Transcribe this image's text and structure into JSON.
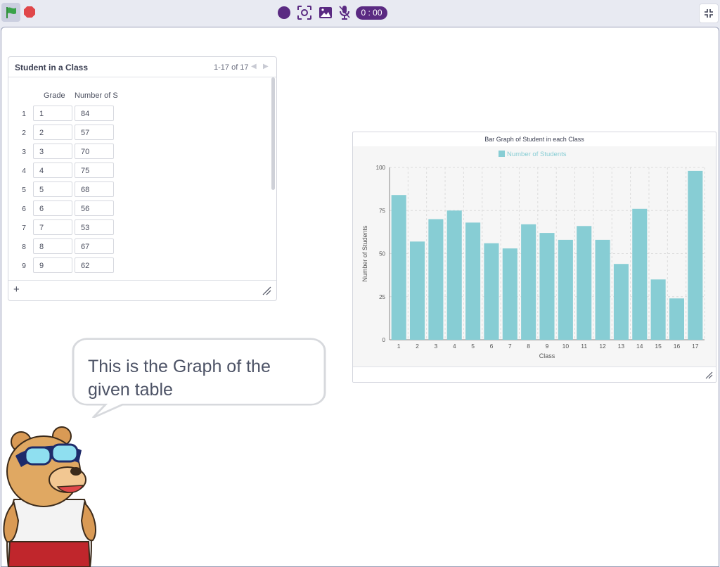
{
  "toolbar": {
    "timer": "0 : 00",
    "icons": [
      "green-flag-icon",
      "stop-icon",
      "record-icon",
      "screenshot-icon",
      "image-icon",
      "microphone-icon",
      "fullscreen-exit-icon"
    ],
    "colors": {
      "flag": "#2f8f3a",
      "stop": "#e0474a",
      "accent": "#5a2a82"
    }
  },
  "table": {
    "title": "Student in a Class",
    "range": "1-17 of 17",
    "columns": [
      "Grade",
      "Number of S"
    ],
    "rows": [
      {
        "n": "1",
        "grade": "1",
        "count": "84"
      },
      {
        "n": "2",
        "grade": "2",
        "count": "57"
      },
      {
        "n": "3",
        "grade": "3",
        "count": "70"
      },
      {
        "n": "4",
        "grade": "4",
        "count": "75"
      },
      {
        "n": "5",
        "grade": "5",
        "count": "68"
      },
      {
        "n": "6",
        "grade": "6",
        "count": "56"
      },
      {
        "n": "7",
        "grade": "7",
        "count": "53"
      },
      {
        "n": "8",
        "grade": "8",
        "count": "67"
      },
      {
        "n": "9",
        "grade": "9",
        "count": "62"
      }
    ],
    "add_label": "+"
  },
  "chart_data": {
    "type": "bar",
    "title": "Bar Graph of Student in each Class",
    "xlabel": "Class",
    "ylabel": "Number of Students",
    "ylim": [
      0,
      100
    ],
    "yticks": [
      0,
      25,
      50,
      75,
      100
    ],
    "grid": true,
    "legend_position": "top",
    "categories": [
      "1",
      "2",
      "3",
      "4",
      "5",
      "6",
      "7",
      "8",
      "9",
      "10",
      "11",
      "12",
      "13",
      "14",
      "15",
      "16",
      "17"
    ],
    "series": [
      {
        "name": "Number of Students",
        "color": "#87cdd4",
        "values": [
          84,
          57,
          70,
          75,
          68,
          56,
          53,
          67,
          62,
          58,
          66,
          58,
          44,
          76,
          35,
          24,
          98
        ]
      }
    ]
  },
  "bubble": {
    "text_line1": "This is the Graph of the",
    "text_line2": "given table"
  }
}
